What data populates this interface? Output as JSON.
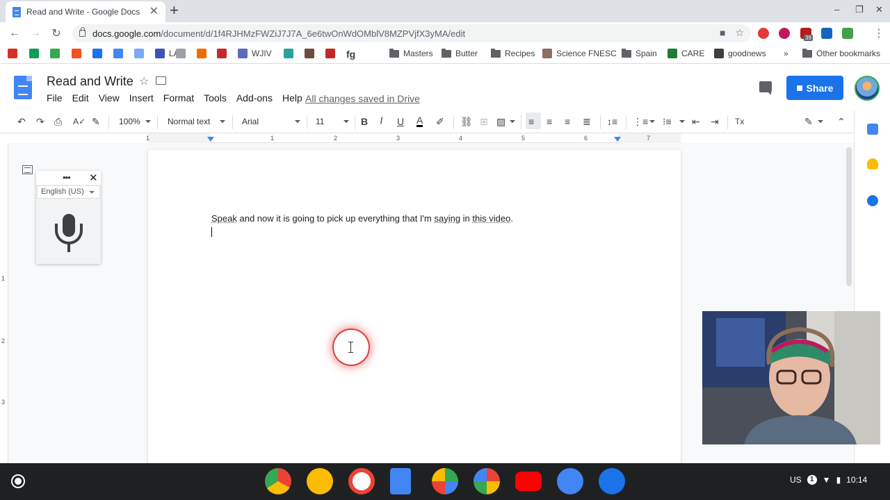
{
  "browser": {
    "tab_title": "Read and Write - Google Docs",
    "tab_close": "✕",
    "new_tab": "+",
    "window_controls": [
      "–",
      "❐",
      "✕"
    ],
    "url_host": "docs.google.com",
    "url_path": "/document/d/1f4RJHMzFWZiJ7J7A_6e6twOnWdOMblV8MZPVjfX3yMA/edit",
    "nav": {
      "back": "←",
      "forward": "→",
      "reload": "↻"
    },
    "omnibox_icons": {
      "camera": "■",
      "bookmark_star": "☆"
    },
    "menu_dots": "⋮",
    "extension_badge": "39"
  },
  "bookmarks": [
    {
      "label": "",
      "icon": "maple-leaf-icon",
      "color": "#d93025"
    },
    {
      "label": "",
      "icon": "sheets-icon",
      "color": "#0f9d58"
    },
    {
      "label": "",
      "icon": "leaf-icon",
      "color": "#34a853"
    },
    {
      "label": "",
      "icon": "windows-icon",
      "color": "#f25022"
    },
    {
      "label": "",
      "icon": "people-icon",
      "color": "#1a73e8"
    },
    {
      "label": "",
      "icon": "f-icon",
      "color": "#4285f4"
    },
    {
      "label": "",
      "icon": "ac-icon",
      "color": "#7baaf7"
    },
    {
      "label": "LAT",
      "icon": "lat-icon",
      "color": "#3f51b5"
    },
    {
      "label": "",
      "icon": "circle-icon",
      "color": "#9aa0a6"
    },
    {
      "label": "",
      "icon": "swirl-icon",
      "color": "#ef6c00"
    },
    {
      "label": "",
      "icon": "red-square-icon",
      "color": "#c62828"
    },
    {
      "label": "WJIV",
      "icon": "wjiv-icon",
      "color": "#5c6bc0"
    },
    {
      "label": "",
      "icon": "loading-icon",
      "color": "#26a69a"
    },
    {
      "label": "",
      "icon": "camera-icon",
      "color": "#6d4c41"
    },
    {
      "label": "",
      "icon": "m-icon",
      "color": "#c62828"
    },
    {
      "label": "fg",
      "icon": "",
      "color": "#202124"
    },
    {
      "label": "Masters",
      "icon": "folder-icon",
      "color": "#5f6368"
    },
    {
      "label": "Butter",
      "icon": "folder-icon",
      "color": "#5f6368"
    },
    {
      "label": "Recipes",
      "icon": "folder-icon",
      "color": "#5f6368"
    },
    {
      "label": "Science FNESC",
      "icon": "science-icon",
      "color": "#8d6e63"
    },
    {
      "label": "Spain",
      "icon": "folder-icon",
      "color": "#5f6368"
    },
    {
      "label": "CARE",
      "icon": "excel-icon",
      "color": "#1e7e34"
    },
    {
      "label": "goodnews",
      "icon": "goodnews-icon",
      "color": "#3c4043"
    },
    {
      "label": "»",
      "icon": "",
      "color": "#3c4043"
    },
    {
      "label": "Other bookmarks",
      "icon": "folder-icon",
      "color": "#5f6368"
    }
  ],
  "docs": {
    "title": "Read and Write",
    "menus": [
      "File",
      "Edit",
      "View",
      "Insert",
      "Format",
      "Tools",
      "Add-ons",
      "Help"
    ],
    "saved_status": "All changes saved in Drive",
    "share_label": "Share"
  },
  "toolbar": {
    "zoom": "100%",
    "style": "Normal text",
    "font": "Arial",
    "size": "11",
    "bold": "B",
    "italic": "I",
    "underline": "U",
    "text_color": "A",
    "undo": "↶",
    "redo": "↷",
    "print": "⎙",
    "paint_format": "✎",
    "link": "⛓",
    "clear_formatting": "Tx",
    "editing_mode": "✎",
    "collapse": "⌃"
  },
  "ruler": {
    "numbers": [
      "1",
      "1",
      "2",
      "3",
      "4",
      "5",
      "6",
      "7"
    ],
    "vertical_numbers": [
      "1",
      "1",
      "2",
      "3"
    ]
  },
  "document": {
    "text_parts": [
      {
        "t": "Speak",
        "flag": true
      },
      {
        "t": " and now it is going to pick up everything that I'm ",
        "flag": false
      },
      {
        "t": "saying",
        "flag": true
      },
      {
        "t": " in ",
        "flag": false
      },
      {
        "t": "this video",
        "flag": true
      },
      {
        "t": ".",
        "flag": false
      }
    ]
  },
  "voice_typing": {
    "language": "English (US)",
    "more": "•••",
    "close": "✕"
  },
  "tray": {
    "locale": "US",
    "notification_count": "1",
    "time": "10:14"
  },
  "colors": {
    "accent": "#1a73e8",
    "docs_blue": "#4285f4",
    "shelf": "#1f2022",
    "tab_strip": "#dee1e6"
  }
}
